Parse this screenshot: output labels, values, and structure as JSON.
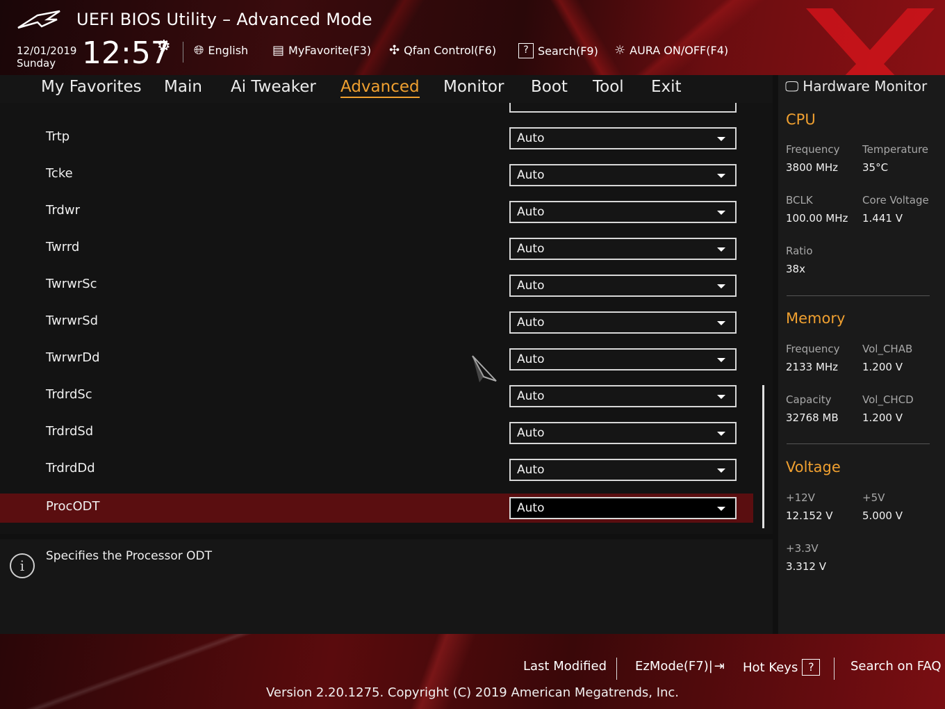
{
  "header": {
    "title": "UEFI BIOS Utility – Advanced Mode",
    "date": "12/01/2019",
    "day": "Sunday",
    "time": "12:57",
    "menu": [
      {
        "label": "English",
        "icon": "globe-icon"
      },
      {
        "label": "MyFavorite(F3)",
        "icon": "favorite-list-icon"
      },
      {
        "label": "Qfan Control(F6)",
        "icon": "fan-icon"
      },
      {
        "label": "Search(F9)",
        "icon": "search-help-icon"
      },
      {
        "label": "AURA ON/OFF(F4)",
        "icon": "aura-light-icon"
      }
    ]
  },
  "tabs": [
    "My Favorites",
    "Main",
    "Ai Tweaker",
    "Advanced",
    "Monitor",
    "Boot",
    "Tool",
    "Exit"
  ],
  "active_tab": "Advanced",
  "settings": [
    {
      "label": "Trtp",
      "value": "Auto"
    },
    {
      "label": "Tcke",
      "value": "Auto"
    },
    {
      "label": "Trdwr",
      "value": "Auto"
    },
    {
      "label": "Twrrd",
      "value": "Auto"
    },
    {
      "label": "TwrwrSc",
      "value": "Auto"
    },
    {
      "label": "TwrwrSd",
      "value": "Auto"
    },
    {
      "label": "TwrwrDd",
      "value": "Auto"
    },
    {
      "label": "TrdrdSc",
      "value": "Auto"
    },
    {
      "label": "TrdrdSd",
      "value": "Auto"
    },
    {
      "label": "TrdrdDd",
      "value": "Auto"
    },
    {
      "label": "ProcODT",
      "value": "Auto"
    }
  ],
  "selected_setting": "ProcODT",
  "help": {
    "text": "Specifies the Processor ODT"
  },
  "hw_monitor": {
    "title": "Hardware Monitor",
    "cpu": {
      "heading": "CPU",
      "frequency_label": "Frequency",
      "frequency": "3800 MHz",
      "temperature_label": "Temperature",
      "temperature": "35°C",
      "bclk_label": "BCLK",
      "bclk": "100.00 MHz",
      "core_voltage_label": "Core Voltage",
      "core_voltage": "1.441 V",
      "ratio_label": "Ratio",
      "ratio": "38x"
    },
    "memory": {
      "heading": "Memory",
      "frequency_label": "Frequency",
      "frequency": "2133 MHz",
      "vol_chab_label": "Vol_CHAB",
      "vol_chab": "1.200 V",
      "capacity_label": "Capacity",
      "capacity": "32768 MB",
      "vol_chcd_label": "Vol_CHCD",
      "vol_chcd": "1.200 V"
    },
    "voltage": {
      "heading": "Voltage",
      "v12_label": "+12V",
      "v12": "12.152 V",
      "v5_label": "+5V",
      "v5": "5.000 V",
      "v33_label": "+3.3V",
      "v33": "3.312 V"
    }
  },
  "footer": {
    "last_modified": "Last Modified",
    "ezmode": "EzMode(F7)|",
    "hotkeys": "Hot Keys",
    "hotkeys_key": "?",
    "faq": "Search on FAQ",
    "version": "Version 2.20.1275. Copyright (C) 2019 American Megatrends, Inc."
  },
  "colors": {
    "accent": "#f0a030",
    "selected_row": "#5a0e10",
    "brand_red": "#c0141a"
  }
}
